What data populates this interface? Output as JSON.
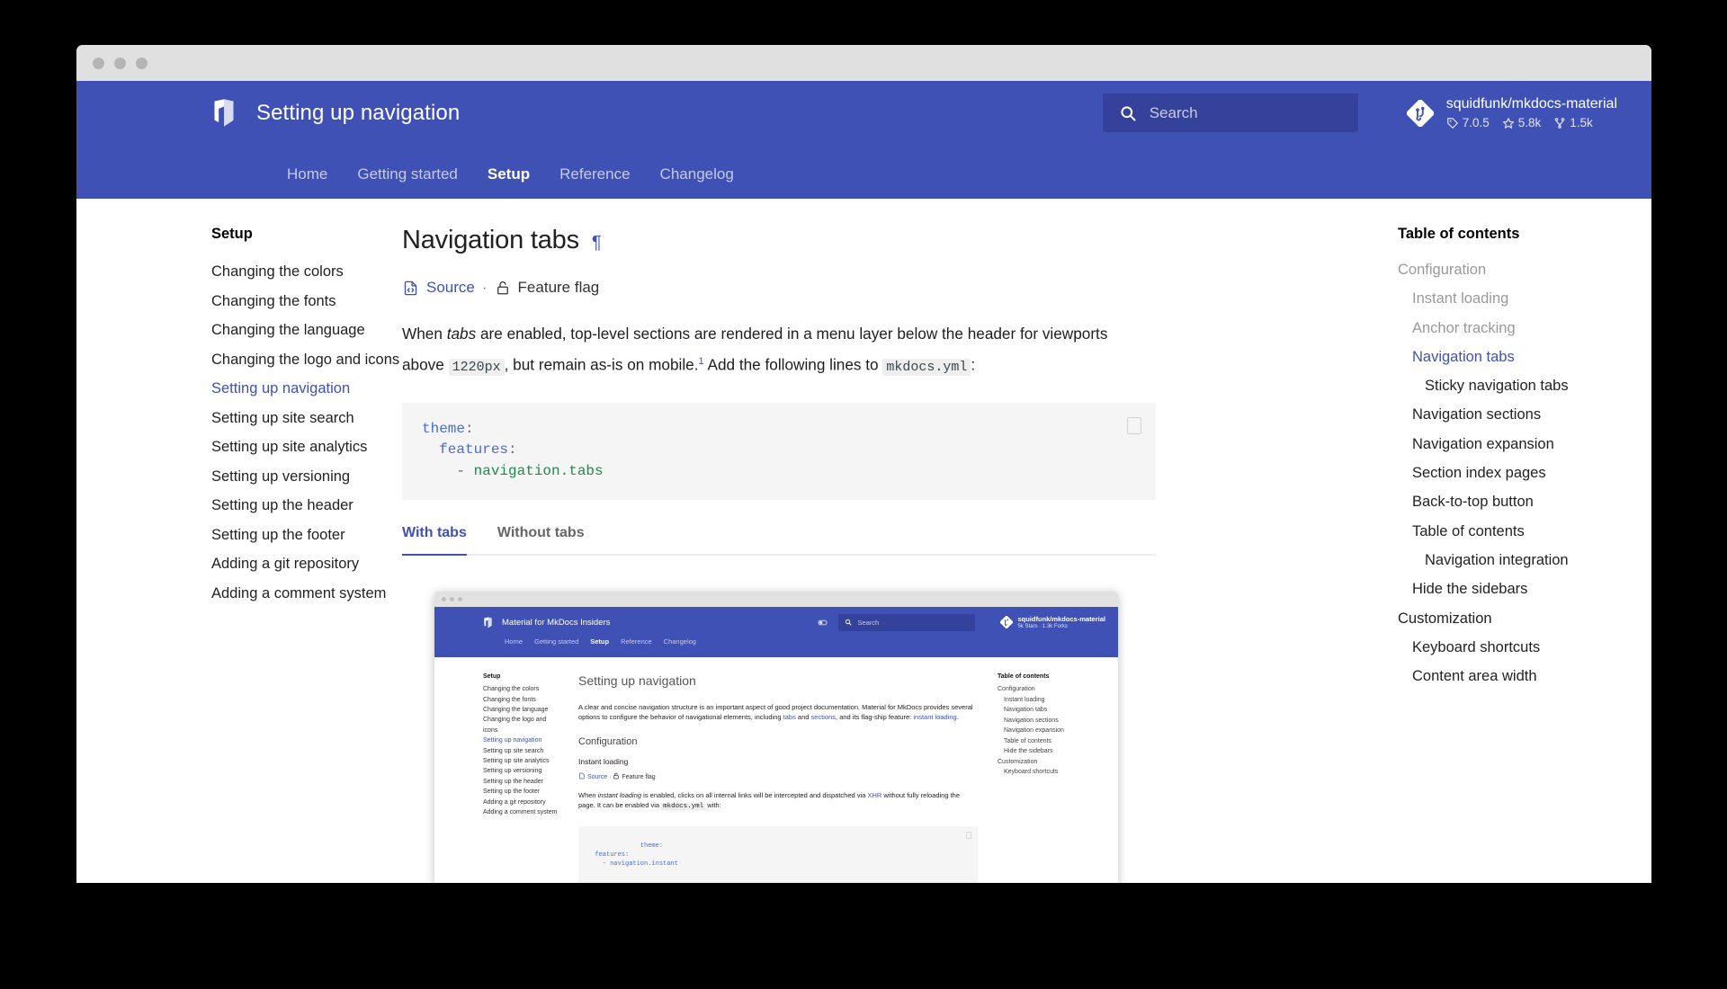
{
  "window": {
    "traffic_lights": 3
  },
  "header": {
    "logo_icon": "mkdocs-material-logo-icon",
    "title": "Setting up navigation",
    "search": {
      "icon": "search-icon",
      "placeholder": "Search",
      "value": ""
    },
    "repo": {
      "icon": "git-repo-icon",
      "name": "squidfunk/mkdocs-material",
      "version": "7.0.5",
      "version_icon": "tag-icon",
      "stars": "5.8k",
      "stars_icon": "star-icon",
      "forks": "1.5k",
      "forks_icon": "fork-icon"
    },
    "nav": [
      {
        "label": "Home",
        "active": false
      },
      {
        "label": "Getting started",
        "active": false
      },
      {
        "label": "Setup",
        "active": true
      },
      {
        "label": "Reference",
        "active": false
      },
      {
        "label": "Changelog",
        "active": false
      }
    ]
  },
  "sidebar": {
    "title": "Setup",
    "items": [
      {
        "label": "Changing the colors",
        "active": false
      },
      {
        "label": "Changing the fonts",
        "active": false
      },
      {
        "label": "Changing the language",
        "active": false
      },
      {
        "label": "Changing the logo and icons",
        "active": false
      },
      {
        "label": "Setting up navigation",
        "active": true
      },
      {
        "label": "Setting up site search",
        "active": false
      },
      {
        "label": "Setting up site analytics",
        "active": false
      },
      {
        "label": "Setting up versioning",
        "active": false
      },
      {
        "label": "Setting up the header",
        "active": false
      },
      {
        "label": "Setting up the footer",
        "active": false
      },
      {
        "label": "Adding a git repository",
        "active": false
      },
      {
        "label": "Adding a comment system",
        "active": false
      }
    ]
  },
  "main": {
    "heading": "Navigation tabs",
    "heading_anchor": "¶",
    "meta": {
      "source_icon": "file-code-icon",
      "source_label": "Source",
      "separator": "·",
      "flag_icon": "lock-open-icon",
      "flag_label": "Feature flag"
    },
    "paragraph": {
      "part1": "When ",
      "em1": "tabs",
      "part2": " are enabled, top-level sections are rendered in a menu layer below the header for viewports above ",
      "code1": "1220px",
      "part3": ", but remain as-is on mobile.",
      "footnote": "1",
      "part4": " Add the following lines to ",
      "code2": "mkdocs.yml",
      "part5": ":"
    },
    "codeblock": {
      "copy_icon": "copy-icon",
      "lines": [
        {
          "key": "theme",
          "punc": ":",
          "indent": 0
        },
        {
          "key": "features",
          "punc": ":",
          "indent": 1
        },
        {
          "dash": "- ",
          "value": "navigation.tabs",
          "indent": 2
        }
      ]
    },
    "tabs": [
      {
        "label": "With tabs",
        "active": true
      },
      {
        "label": "Without tabs",
        "active": false
      }
    ]
  },
  "screenshot": {
    "header": {
      "logo_icon": "mkdocs-material-logo-icon",
      "title": "Material for MkDocs Insiders",
      "toggle_icon": "palette-toggle-icon",
      "search_icon": "search-icon",
      "search_placeholder": "Search",
      "repo_icon": "git-repo-icon",
      "repo_name": "squidfunk/mkdocs-material",
      "repo_facts": "5k Stars · 1.3k Forks",
      "nav": [
        {
          "label": "Home",
          "active": false
        },
        {
          "label": "Getting started",
          "active": false
        },
        {
          "label": "Setup",
          "active": true
        },
        {
          "label": "Reference",
          "active": false
        },
        {
          "label": "Changelog",
          "active": false
        }
      ]
    },
    "sidebar": {
      "title": "Setup",
      "items": [
        {
          "label": "Changing the colors",
          "active": false
        },
        {
          "label": "Changing the fonts",
          "active": false
        },
        {
          "label": "Changing the language",
          "active": false
        },
        {
          "label": "Changing the logo and icons",
          "active": false
        },
        {
          "label": "Setting up navigation",
          "active": true
        },
        {
          "label": "Setting up site search",
          "active": false
        },
        {
          "label": "Setting up site analytics",
          "active": false
        },
        {
          "label": "Setting up versioning",
          "active": false
        },
        {
          "label": "Setting up the header",
          "active": false
        },
        {
          "label": "Setting up the footer",
          "active": false
        },
        {
          "label": "Adding a git repository",
          "active": false
        },
        {
          "label": "Adding a comment system",
          "active": false
        }
      ]
    },
    "content": {
      "h1": "Setting up navigation",
      "intro_a": "A clear and concise navigation structure is an important aspect of good project documentation. Material for MkDocs provides several options to configure the behavior of navigational elements, including ",
      "intro_link1": "tabs",
      "intro_b": " and ",
      "intro_link2": "sections",
      "intro_c": ", and its flag-ship feature: ",
      "intro_link3": "instant loading",
      "intro_d": ".",
      "h2": "Configuration",
      "h3": "Instant loading",
      "meta_source": "Source",
      "meta_sep": "·",
      "meta_flag": "Feature flag",
      "para_a": "When ",
      "para_em": "instant loading",
      "para_b": " is enabled, clicks on all internal links will be intercepted and dispatched via ",
      "para_link": "XHR",
      "para_c": " without fully reloading the page. It can be enabled via ",
      "para_code": "mkdocs.yml",
      "para_d": " with:",
      "code": "theme:\n  features:\n    - navigation.instant"
    },
    "toc": {
      "title": "Table of contents",
      "items": [
        {
          "label": "Configuration",
          "level": 1
        },
        {
          "label": "Instant loading",
          "level": 2
        },
        {
          "label": "Navigation tabs",
          "level": 2
        },
        {
          "label": "Navigation sections",
          "level": 2
        },
        {
          "label": "Navigation expansion",
          "level": 2
        },
        {
          "label": "Table of contents",
          "level": 2
        },
        {
          "label": "Hide the sidebars",
          "level": 2
        },
        {
          "label": "Customization",
          "level": 1
        },
        {
          "label": "Keyboard shortcuts",
          "level": 2
        }
      ]
    }
  },
  "toc": {
    "title": "Table of contents",
    "items": [
      {
        "label": "Configuration",
        "level": 1,
        "state": "dim"
      },
      {
        "label": "Instant loading",
        "level": 2,
        "state": "dim"
      },
      {
        "label": "Anchor tracking",
        "level": 2,
        "state": "dim"
      },
      {
        "label": "Navigation tabs",
        "level": 2,
        "state": "active"
      },
      {
        "label": "Sticky navigation tabs",
        "level": 3,
        "state": "normal"
      },
      {
        "label": "Navigation sections",
        "level": 2,
        "state": "normal"
      },
      {
        "label": "Navigation expansion",
        "level": 2,
        "state": "normal"
      },
      {
        "label": "Section index pages",
        "level": 2,
        "state": "normal"
      },
      {
        "label": "Back-to-top button",
        "level": 2,
        "state": "normal"
      },
      {
        "label": "Table of contents",
        "level": 2,
        "state": "normal"
      },
      {
        "label": "Navigation integration",
        "level": 3,
        "state": "normal"
      },
      {
        "label": "Hide the sidebars",
        "level": 2,
        "state": "normal"
      },
      {
        "label": "Customization",
        "level": 1,
        "state": "normal"
      },
      {
        "label": "Keyboard shortcuts",
        "level": 2,
        "state": "normal"
      },
      {
        "label": "Content area width",
        "level": 2,
        "state": "normal"
      }
    ]
  },
  "colors": {
    "primary": "#3f51b5",
    "search_bg": "#35429c",
    "code_bg": "#f5f5f5",
    "titlebar": "#e0e0e0",
    "link": "#3f51b5",
    "code_key": "#4a6cd4",
    "code_string": "#1f8a4c"
  }
}
